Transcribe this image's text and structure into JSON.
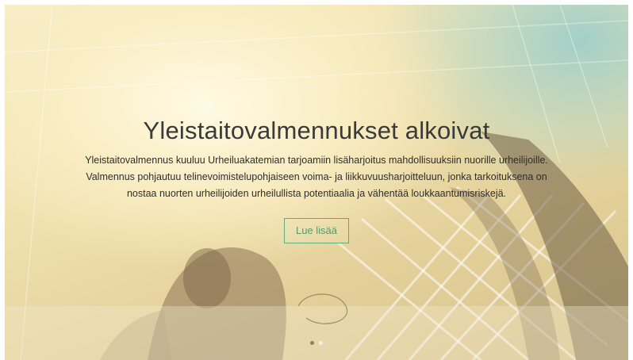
{
  "slider": {
    "slides_total": 2,
    "active_slide": 2
  },
  "hero": {
    "title": "Yleistaitovalmennukset alkoivat",
    "text": "Yleistaitovalmennus kuuluu Urheiluakatemian tarjoamiin lisäharjoitus mahdollisuuksiin nuorille urheilijoille. Valmennus pohjautuu telinevoimistelupohjaiseen voima- ja liikkuvuusharjoitteluun, jonka tarkoituksena on nostaa nuorten urheilijoiden urheilullista potentiaalia ja vähentää loukkaantumisriskejä.",
    "button_label": "Lue lisää"
  },
  "colors": {
    "accent": "#5fae7a",
    "title": "#3a3a3a",
    "text": "#2e2e2e"
  }
}
